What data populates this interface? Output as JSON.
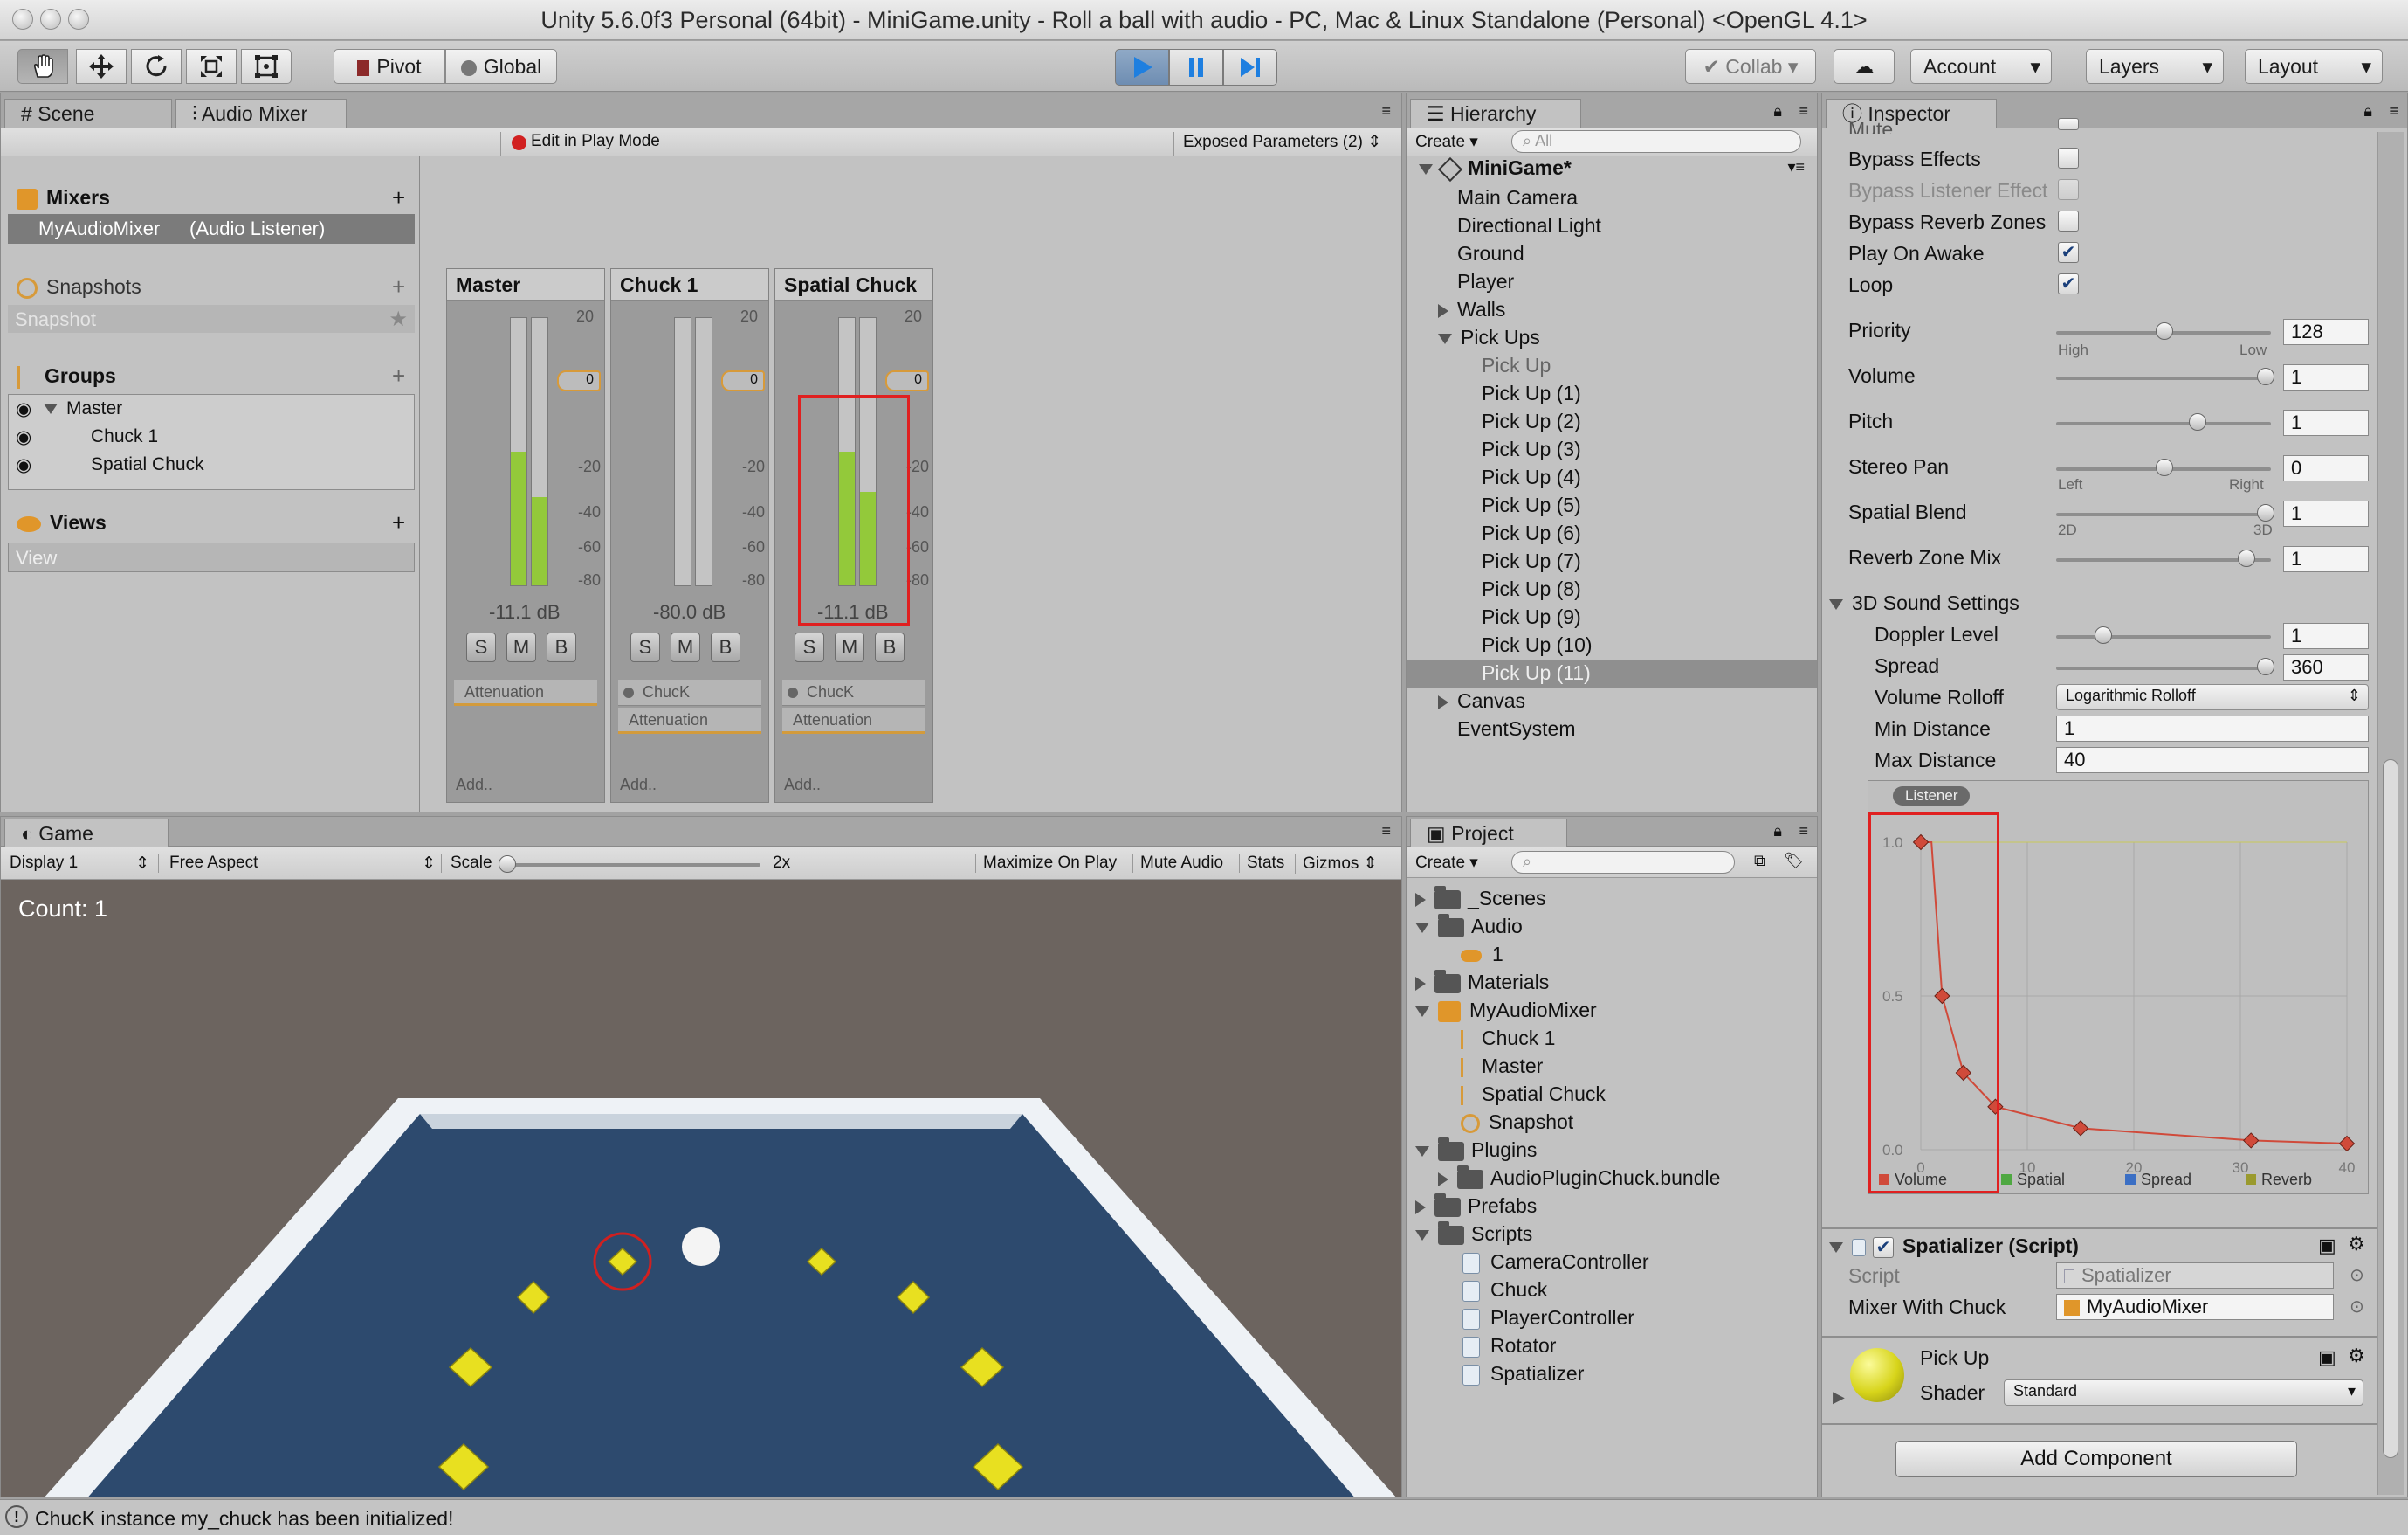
{
  "window": {
    "title": "Unity 5.6.0f3 Personal (64bit) - MiniGame.unity - Roll a ball with audio - PC, Mac & Linux Standalone (Personal) <OpenGL 4.1>"
  },
  "toolbar": {
    "pivot": "Pivot",
    "global": "Global",
    "collab": "Collab",
    "account": "Account",
    "layers": "Layers",
    "layout": "Layout",
    "play_active": true
  },
  "mixer_panel": {
    "tabs": [
      "Scene",
      "Audio Mixer"
    ],
    "edit_in_play": "Edit in Play Mode",
    "exposed_params": "Exposed Parameters (2)",
    "mixers_title": "Mixers",
    "mixer_item": "MyAudioMixer",
    "mixer_item_note": "(Audio Listener)",
    "snapshots_title": "Snapshots",
    "snapshot_item": "Snapshot",
    "groups_title": "Groups",
    "groups": [
      "Master",
      "Chuck 1",
      "Spatial Chuck"
    ],
    "views_title": "Views",
    "view_item": "View",
    "strips": [
      {
        "name": "Master",
        "db": "-11.1 dB",
        "levels": [
          0.5,
          0.33
        ],
        "effects": [
          "Attenuation"
        ],
        "add": "Add.."
      },
      {
        "name": "Chuck 1",
        "db": "-80.0 dB",
        "levels": [
          0,
          0
        ],
        "effects": [
          "ChucK",
          "Attenuation"
        ],
        "add": "Add.."
      },
      {
        "name": "Spatial Chuck",
        "db": "-11.1 dB",
        "levels": [
          0.5,
          0.35
        ],
        "effects": [
          "ChucK",
          "Attenuation"
        ],
        "add": "Add.."
      }
    ],
    "scale_ticks": [
      "20",
      "0",
      "-20",
      "-40",
      "-60",
      "-80"
    ],
    "fader_value": "0",
    "smb": [
      "S",
      "M",
      "B"
    ]
  },
  "game_panel": {
    "tab": "Game",
    "display": "Display 1",
    "aspect": "Free Aspect",
    "scale_label": "Scale",
    "scale_value": "2x",
    "buttons": [
      "Maximize On Play",
      "Mute Audio",
      "Stats",
      "Gizmos"
    ],
    "count_text": "Count: 1"
  },
  "hierarchy": {
    "tab": "Hierarchy",
    "create": "Create",
    "search_placeholder": "All",
    "scene": "MiniGame*",
    "items": [
      "Main Camera",
      "Directional Light",
      "Ground",
      "Player",
      "Walls",
      "Pick Ups",
      "Pick Up",
      "Pick Up (1)",
      "Pick Up (2)",
      "Pick Up (3)",
      "Pick Up (4)",
      "Pick Up (5)",
      "Pick Up (6)",
      "Pick Up (7)",
      "Pick Up (8)",
      "Pick Up (9)",
      "Pick Up (10)",
      "Pick Up (11)",
      "Canvas",
      "EventSystem"
    ],
    "selected": "Pick Up (11)"
  },
  "project": {
    "tab": "Project",
    "create": "Create",
    "items": [
      "_Scenes",
      "Audio",
      "1",
      "Materials",
      "MyAudioMixer",
      "Chuck 1",
      "Master",
      "Spatial Chuck",
      "Snapshot",
      "Plugins",
      "AudioPluginChuck.bundle",
      "Prefabs",
      "Scripts",
      "CameraController",
      "Chuck",
      "PlayerController",
      "Rotator",
      "Spatializer"
    ]
  },
  "inspector": {
    "tab": "Inspector",
    "mute": "Mute",
    "bypass_effects": "Bypass Effects",
    "bypass_listener": "Bypass Listener Effect",
    "bypass_reverb": "Bypass Reverb Zones",
    "play_on_awake": "Play On Awake",
    "loop": "Loop",
    "priority": {
      "label": "Priority",
      "value": "128",
      "left": "High",
      "right": "Low",
      "pos": 0.5
    },
    "volume": {
      "label": "Volume",
      "value": "1",
      "pos": 1.0
    },
    "pitch": {
      "label": "Pitch",
      "value": "1",
      "pos": 0.66
    },
    "stereo_pan": {
      "label": "Stereo Pan",
      "value": "0",
      "left": "Left",
      "right": "Right",
      "pos": 0.5
    },
    "spatial_blend": {
      "label": "Spatial Blend",
      "value": "1",
      "left": "2D",
      "right": "3D",
      "pos": 1.0
    },
    "reverb_mix": {
      "label": "Reverb Zone Mix",
      "value": "1",
      "pos": 0.9
    },
    "sound3d_title": "3D Sound Settings",
    "doppler": {
      "label": "Doppler Level",
      "value": "1",
      "pos": 0.22
    },
    "spread": {
      "label": "Spread",
      "value": "360",
      "pos": 1.0
    },
    "rolloff": {
      "label": "Volume Rolloff",
      "value": "Logarithmic Rolloff"
    },
    "min_dist": {
      "label": "Min Distance",
      "value": "1"
    },
    "max_dist": {
      "label": "Max Distance",
      "value": "40"
    },
    "graph": {
      "badge": "Listener",
      "y_ticks": [
        "1.0",
        "0.5",
        "0.0"
      ],
      "x_ticks": [
        "0",
        "10",
        "20",
        "30",
        "40"
      ],
      "legend": [
        "Volume",
        "Spatial",
        "Spread",
        "Reverb"
      ],
      "legend_colors": [
        "#d04a3a",
        "#4fa842",
        "#3b6fc4",
        "#9a9a2e"
      ]
    },
    "spatializer_title": "Spatializer (Script)",
    "script_label": "Script",
    "script_value": "Spatializer",
    "mixer_chuck_label": "Mixer With Chuck",
    "mixer_chuck_value": "MyAudioMixer",
    "material_title": "Pick Up",
    "shader_label": "Shader",
    "shader_value": "Standard",
    "add_component": "Add Component"
  },
  "status": {
    "message": "ChucK instance my_chuck has been initialized!"
  },
  "chart_data": {
    "type": "line",
    "title": "",
    "series": [
      {
        "name": "Volume",
        "x": [
          0,
          1,
          2,
          4,
          7,
          15,
          31,
          40
        ],
        "y": [
          1.0,
          1.0,
          0.5,
          0.25,
          0.14,
          0.07,
          0.03,
          0.02
        ]
      }
    ],
    "xlim": [
      0,
      40
    ],
    "ylim": [
      0,
      1.0
    ]
  }
}
